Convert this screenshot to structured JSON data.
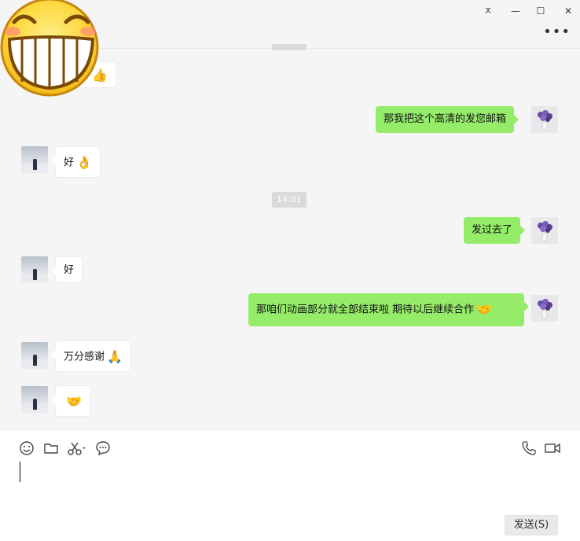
{
  "window": {
    "pin_label": "ㅈ",
    "minimize_label": "—",
    "maximize_label": "☐",
    "close_label": "✕",
    "more_label": "•••"
  },
  "messages": [
    {
      "from": "other",
      "text": "",
      "emoji": "👍"
    },
    {
      "from": "me",
      "text": "那我把这个高清的发您邮箱"
    },
    {
      "from": "other",
      "text": "好",
      "emoji": "👌"
    },
    {
      "from": "me",
      "text": "发过去了"
    },
    {
      "from": "other",
      "text": "好"
    },
    {
      "from": "me",
      "text": "那咱们动画部分就全部结束啦  期待以后继续合作",
      "emoji": "🤝"
    },
    {
      "from": "other",
      "text": "万分感谢",
      "emoji": "🙏"
    },
    {
      "from": "other",
      "text": "",
      "emoji": "🤝"
    }
  ],
  "timestamp": "14:01",
  "toolbar": {
    "emoji_icon": "emoji-icon",
    "folder_icon": "folder-icon",
    "scissors_icon": "scissors-icon",
    "chat_history_icon": "chat-history-icon",
    "voice_call_icon": "phone-icon",
    "video_call_icon": "video-icon"
  },
  "send_button": "发送(S)",
  "colors": {
    "my_bubble": "#95ec69",
    "other_bubble": "#ffffff",
    "background": "#f5f5f5"
  }
}
